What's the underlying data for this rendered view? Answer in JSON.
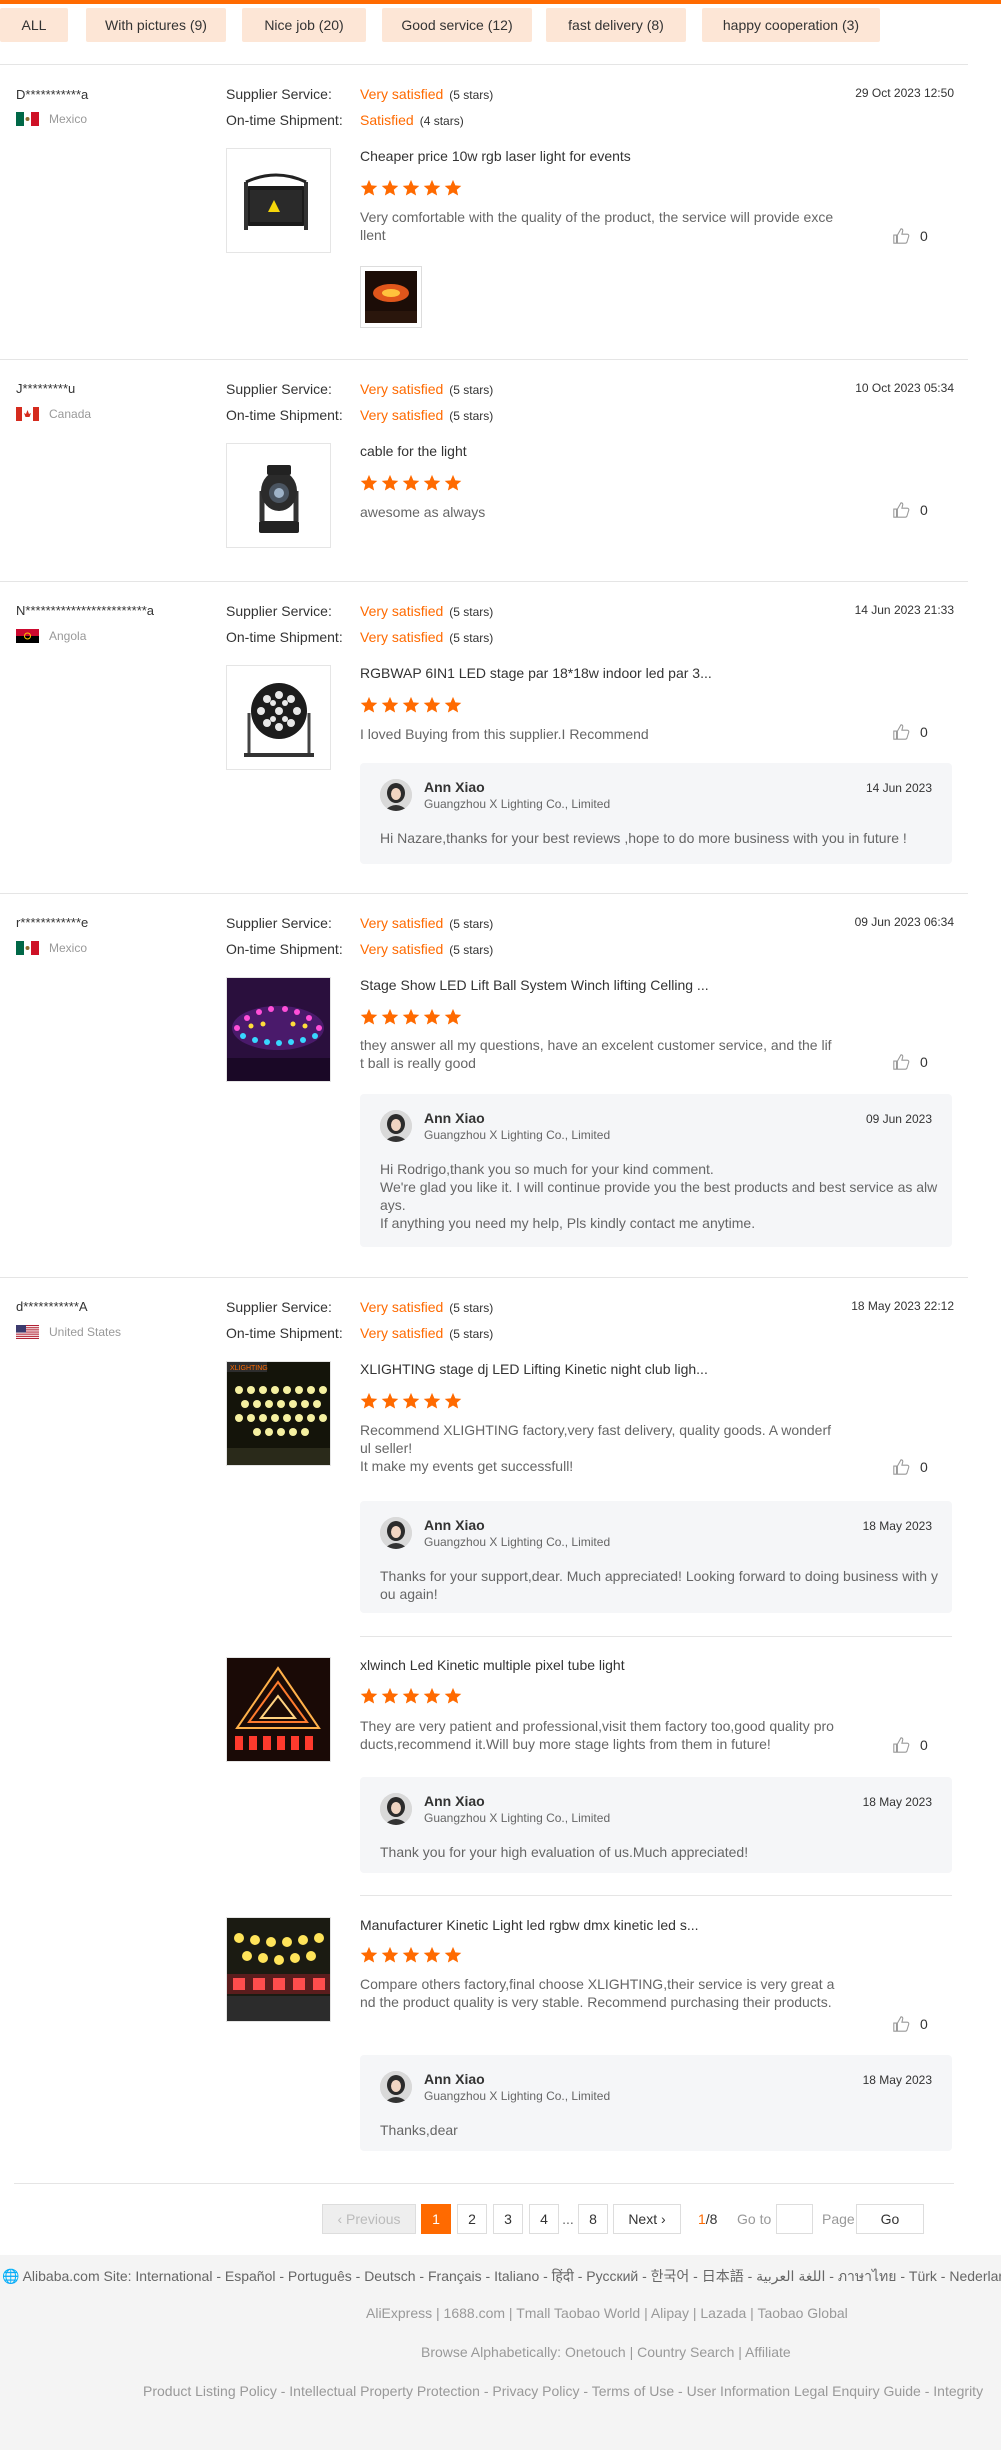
{
  "accent": "#ff6a00",
  "filters": [
    {
      "label": "ALL"
    },
    {
      "label": "With pictures (9)"
    },
    {
      "label": "Nice job (20)"
    },
    {
      "label": "Good service (12)"
    },
    {
      "label": "fast delivery (8)"
    },
    {
      "label": "happy cooperation (3)"
    }
  ],
  "labels": {
    "supplier_service": "Supplier Service:",
    "ontime_shipment": "On-time Shipment:"
  },
  "reviews": [
    {
      "user": "D***********a",
      "country": "Mexico",
      "flag": "mexico-flag-icon",
      "supplier_value": "Very satisfied",
      "supplier_stars": "(5 stars)",
      "shipment_value": "Satisfied",
      "shipment_stars": "(4 stars)",
      "date": "29 Oct 2023 12:50",
      "items": [
        {
          "title": "Cheaper price 10w rgb laser light for events",
          "comment": "Very comfortable with the quality of the product, the service will provide excellent",
          "likes": "0"
        }
      ]
    },
    {
      "user": "J*********u",
      "country": "Canada",
      "flag": "canada-flag-icon",
      "supplier_value": "Very satisfied",
      "supplier_stars": "(5 stars)",
      "shipment_value": "Very satisfied",
      "shipment_stars": "(5 stars)",
      "date": "10 Oct 2023 05:34",
      "items": [
        {
          "title": "cable for the light",
          "comment": "awesome as always",
          "likes": "0"
        }
      ]
    },
    {
      "user": "N************************a",
      "country": "Angola",
      "flag": "angola-flag-icon",
      "supplier_value": "Very satisfied",
      "supplier_stars": "(5 stars)",
      "shipment_value": "Very satisfied",
      "shipment_stars": "(5 stars)",
      "date": "14 Jun 2023 21:33",
      "items": [
        {
          "title": "RGBWAP 6IN1 LED stage par 18*18w indoor led par 3...",
          "comment": "I loved  Buying from this supplier.I Recommend",
          "likes": "0",
          "reply": {
            "name": "Ann Xiao",
            "company": "Guangzhou X Lighting Co., Limited",
            "date": "14 Jun 2023",
            "text": "Hi Nazare,thanks for your best reviews ,hope to do more business with you in future !"
          }
        }
      ]
    },
    {
      "user": "r************e",
      "country": "Mexico",
      "flag": "mexico-flag-icon",
      "supplier_value": "Very satisfied",
      "supplier_stars": "(5 stars)",
      "shipment_value": "Very satisfied",
      "shipment_stars": "(5 stars)",
      "date": "09 Jun 2023 06:34",
      "items": [
        {
          "title": "Stage Show LED Lift Ball System Winch lifting Celling ...",
          "comment": "they answer all my questions, have an excelent customer service, and the lift ball is really good",
          "likes": "0",
          "reply": {
            "name": "Ann Xiao",
            "company": "Guangzhou X Lighting Co., Limited",
            "date": "09 Jun 2023",
            "text": "Hi Rodrigo,thank you so much for your kind comment.\nWe're glad you like it. I will continue provide you the best products and best service as always.\nIf anything you need my help, Pls kindly contact me anytime."
          }
        }
      ]
    },
    {
      "user": "d***********A",
      "country": "United States",
      "flag": "usa-flag-icon",
      "supplier_value": "Very satisfied",
      "supplier_stars": "(5 stars)",
      "shipment_value": "Very satisfied",
      "shipment_stars": "(5 stars)",
      "date": "18 May 2023 22:12",
      "items": [
        {
          "title": "XLIGHTING stage dj LED Lifting Kinetic night club ligh...",
          "comment": "Recommend XLIGHTING factory,very fast delivery, quality goods. A wonderful seller!\nIt make my events get successfull!",
          "likes": "0",
          "reply": {
            "name": "Ann Xiao",
            "company": "Guangzhou X Lighting Co., Limited",
            "date": "18 May 2023",
            "text": "Thanks for your support,dear. Much appreciated! Looking forward to doing business with you again!"
          }
        },
        {
          "title": "xlwinch Led Kinetic multiple pixel tube light",
          "comment": "They are very patient and professional,visit them factory too,good quality products,recommend it.Will buy more stage lights from them in future!",
          "likes": "0",
          "reply": {
            "name": "Ann Xiao",
            "company": "Guangzhou X Lighting Co., Limited",
            "date": "18 May 2023",
            "text": "Thank you for your high evaluation of us.Much appreciated!"
          }
        },
        {
          "title": "Manufacturer Kinetic Light led rgbw dmx kinetic led s...",
          "comment": "Compare others factory,final choose XLIGHTING,their service is very great and the product quality is very stable. Recommend purchasing their products.",
          "likes": "0",
          "reply": {
            "name": "Ann Xiao",
            "company": "Guangzhou X Lighting Co., Limited",
            "date": "18 May 2023",
            "text": "Thanks,dear"
          }
        }
      ]
    }
  ],
  "pagination": {
    "prev": "Previous",
    "pages": [
      "1",
      "2",
      "3",
      "4",
      "...",
      "8"
    ],
    "next": "Next",
    "current": "1",
    "total": "/8",
    "goto": "Go to",
    "page_word": "Page",
    "go": "Go"
  },
  "footer": {
    "sites": "Alibaba.com Site: International - Español - Português - Deutsch - Français - Italiano - हिंदी - Pусский - 한국어 - 日本語 - اللغة العربية - ภาษาไทย - Türk - Nederlands",
    "links1": "AliExpress | 1688.com | Tmall Taobao World | Alipay | Lazada | Taobao Global",
    "links2": "Browse Alphabetically: Onetouch | Country Search | Affiliate",
    "links3": "Product Listing Policy - Intellectual Property Protection - Privacy Policy - Terms of Use - User Information Legal Enquiry Guide - Integrity"
  }
}
